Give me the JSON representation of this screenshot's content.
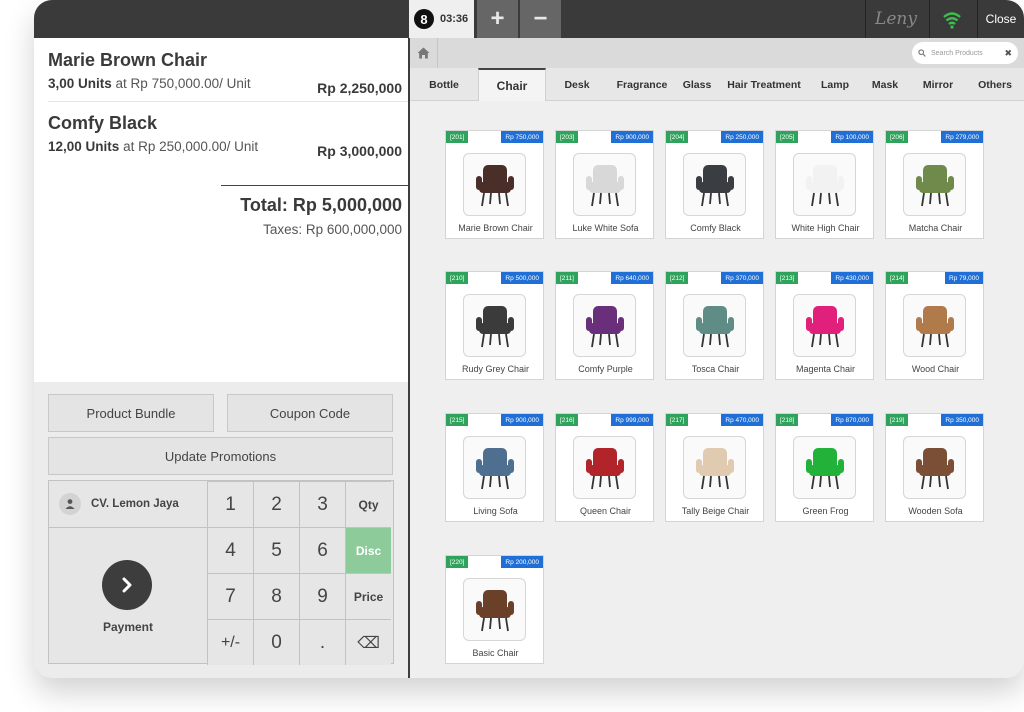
{
  "topbar": {
    "order_number": "8",
    "order_time": "03:36",
    "add_label": "+",
    "remove_label": "−",
    "user": "Leny",
    "close_label": "Close"
  },
  "order": {
    "lines": [
      {
        "name": "Marie Brown Chair",
        "qty": "3,00 Units",
        "unit_text": "at Rp 750,000.00/ Unit",
        "price": "Rp 2,250,000"
      },
      {
        "name": "Comfy Black",
        "qty": "12,00 Units",
        "unit_text": "at Rp 250,000.00/ Unit",
        "price": "Rp 3,000,000"
      }
    ],
    "total": "Total: Rp 5,000,000",
    "taxes": "Taxes: Rp 600,000,000"
  },
  "controls": {
    "product_bundle": "Product Bundle",
    "coupon_code": "Coupon Code",
    "update_promotions": "Update Promotions",
    "customer": "CV. Lemon Jaya",
    "payment": "Payment"
  },
  "numpad": {
    "k1": "1",
    "k2": "2",
    "k3": "3",
    "qty": "Qty",
    "k4": "4",
    "k5": "5",
    "k6": "6",
    "disc": "Disc",
    "k7": "7",
    "k8": "8",
    "k9": "9",
    "price": "Price",
    "plusminus": "+/-",
    "k0": "0",
    "dot": ".",
    "backspace": "⌫"
  },
  "search": {
    "placeholder": "Search Products"
  },
  "categories": [
    "Bottle",
    "Chair",
    "Desk",
    "Fragrance",
    "Glass",
    "Hair Treatment",
    "Lamp",
    "Mask",
    "Mirror",
    "Others"
  ],
  "active_category": "Chair",
  "colors": {
    "code_badge": "#2fa35b",
    "price_badge": "#1f6fd6",
    "disc_key": "#8ecb9a",
    "topbar": "#3a3a3a"
  },
  "products": [
    {
      "code": "[201]",
      "price": "Rp 750,000",
      "name": "Marie Brown Chair",
      "color": "#4a2f28"
    },
    {
      "code": "[203]",
      "price": "Rp 900,000",
      "name": "Luke White Sofa",
      "color": "#d8d8d8"
    },
    {
      "code": "[204]",
      "price": "Rp 250,000",
      "name": "Comfy Black",
      "color": "#3a3d42"
    },
    {
      "code": "[205]",
      "price": "Rp 100,000",
      "name": "White High Chair",
      "color": "#f2f2f2"
    },
    {
      "code": "[206]",
      "price": "Rp 279,000",
      "name": "Matcha Chair",
      "color": "#6f8a4a"
    },
    {
      "code": "[210]",
      "price": "Rp 500,000",
      "name": "Rudy Grey Chair",
      "color": "#3b3b3b"
    },
    {
      "code": "[211]",
      "price": "Rp 640,000",
      "name": "Comfy Purple",
      "color": "#6a2f7a"
    },
    {
      "code": "[212]",
      "price": "Rp 370,000",
      "name": "Tosca Chair",
      "color": "#5f8d86"
    },
    {
      "code": "[213]",
      "price": "Rp 430,000",
      "name": "Magenta Chair",
      "color": "#e0207a"
    },
    {
      "code": "[214]",
      "price": "Rp 79,000",
      "name": "Wood Chair",
      "color": "#b07a4a"
    },
    {
      "code": "[215]",
      "price": "Rp 900,000",
      "name": "Living Sofa",
      "color": "#4f6f90"
    },
    {
      "code": "[216]",
      "price": "Rp 999,000",
      "name": "Queen Chair",
      "color": "#b0242a"
    },
    {
      "code": "[217]",
      "price": "Rp 470,000",
      "name": "Tally Beige Chair",
      "color": "#e0cbb0"
    },
    {
      "code": "[218]",
      "price": "Rp 870,000",
      "name": "Green Frog",
      "color": "#22b23a"
    },
    {
      "code": "[219]",
      "price": "Rp 350,000",
      "name": "Wooden Sofa",
      "color": "#7a4f35"
    },
    {
      "code": "[220]",
      "price": "Rp 200,000",
      "name": "Basic Chair",
      "color": "#6a4028"
    }
  ]
}
